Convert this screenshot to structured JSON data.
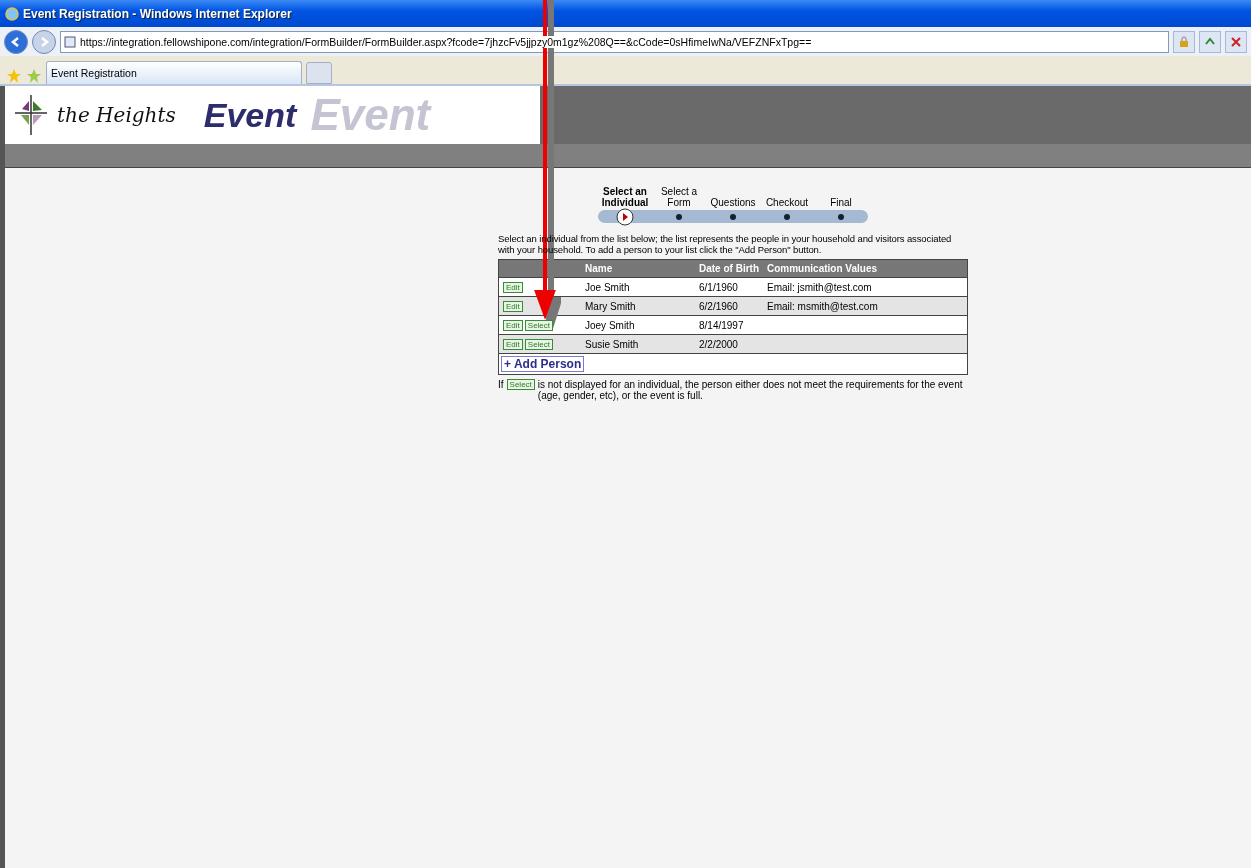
{
  "window": {
    "title": "Event Registration - Windows Internet Explorer"
  },
  "address_bar": {
    "url": "https://integration.fellowshipone.com/integration/FormBuilder/FormBuilder.aspx?fcode=7jhzcFv5jjpzy0m1gz%208Q==&cCode=0sHfimeIwNa/VEFZNFxTpg=="
  },
  "tabs": [
    {
      "label": "Event Registration",
      "selected": true
    }
  ],
  "header": {
    "logo_text": "the Heights",
    "background_text": "Event",
    "title": "Event"
  },
  "steps": [
    {
      "label": "Select an Individual",
      "selected": true
    },
    {
      "label": "Select a Form",
      "selected": false
    },
    {
      "label": "Questions",
      "selected": false
    },
    {
      "label": "Checkout",
      "selected": false
    },
    {
      "label": "Final",
      "selected": false
    }
  ],
  "instructions": "Select an individual from the list below; the list represents the people in your household and visitors associated with your household. To add a person to your list click the \"Add Person\" button.",
  "table": {
    "columns": [
      "Name",
      "Date of Birth",
      "Communication Values"
    ],
    "rows": [
      {
        "actions": [
          "Edit"
        ],
        "name": "Joe Smith",
        "dob": "6/1/1960",
        "communication": "Email: jsmith@test.com"
      },
      {
        "actions": [
          "Edit"
        ],
        "name": "Mary Smith",
        "dob": "6/2/1960",
        "communication": "Email: msmith@test.com"
      },
      {
        "actions": [
          "Edit",
          "Select"
        ],
        "name": "Joey Smith",
        "dob": "8/14/1997",
        "communication": ""
      },
      {
        "actions": [
          "Edit",
          "Select"
        ],
        "name": "Susie Smith",
        "dob": "2/2/2000",
        "communication": ""
      }
    ],
    "add_button": "+ Add Person"
  },
  "note": {
    "prefix": "If",
    "badge": "Select",
    "text": "is not displayed for an individual, the person either does not meet the requirements for the event (age, gender, etc), or the event is full."
  }
}
